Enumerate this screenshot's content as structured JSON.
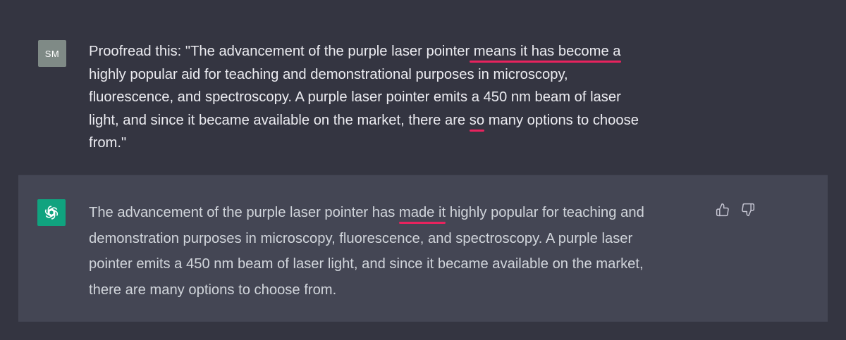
{
  "conversation": {
    "user": {
      "avatar_initials": "SM",
      "lines": [
        {
          "before": "Proofread this: \"The advancement of the purple laser pointer",
          "highlight": " means it has become a",
          "after": ""
        },
        {
          "before": "highly popular aid for teaching and demonstrational purposes in microscopy,",
          "highlight": "",
          "after": ""
        },
        {
          "before": "fluorescence, and spectroscopy. A purple laser pointer emits a 450 nm beam of laser",
          "highlight": "",
          "after": ""
        },
        {
          "before": "light, and since it became available on the market, there are ",
          "highlight": "so",
          "after": " many options to choose"
        },
        {
          "before": "from.\"",
          "highlight": "",
          "after": ""
        }
      ]
    },
    "assistant": {
      "avatar_icon": "openai-logo-icon",
      "lines": [
        {
          "before": "The advancement of the purple laser pointer has ",
          "highlight": "made it",
          "after": " highly popular for teaching and"
        },
        {
          "before": "demonstration purposes in microscopy, fluorescence, and spectroscopy. A purple laser",
          "highlight": "",
          "after": ""
        },
        {
          "before": "pointer emits a 450 nm beam of laser light, and since it became available on the market,",
          "highlight": "",
          "after": ""
        },
        {
          "before": "there are many options to choose from.",
          "highlight": "",
          "after": ""
        }
      ],
      "actions": [
        "thumbs-up-icon",
        "thumbs-down-icon"
      ]
    }
  },
  "colors": {
    "page_background": "#343541",
    "assistant_background": "#444654",
    "user_avatar": "#7f8a86",
    "assistant_avatar": "#10a37f",
    "highlight_underline": "#e8235e"
  }
}
